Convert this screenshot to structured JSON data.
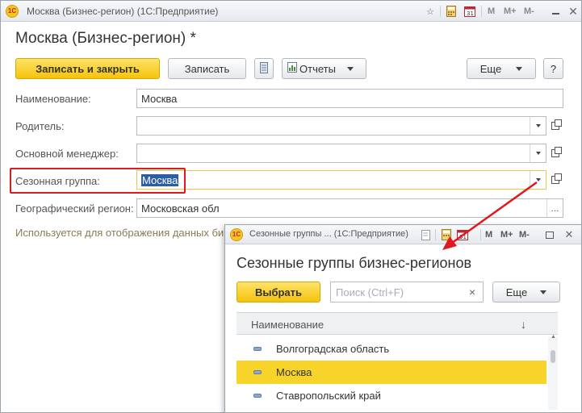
{
  "main_window": {
    "title": "Москва (Бизнес-регион)  (1С:Предприятие)",
    "toolbar_m_labels": [
      "M",
      "M+",
      "M-"
    ],
    "form_title": "Москва (Бизнес-регион) *",
    "buttons": {
      "write_close": "Записать и закрыть",
      "write": "Записать",
      "reports": "Отчеты",
      "more": "Еще",
      "help": "?"
    },
    "fields": {
      "name": {
        "label": "Наименование:",
        "value": "Москва"
      },
      "parent": {
        "label": "Родитель:",
        "value": ""
      },
      "manager": {
        "label": "Основной менеджер:",
        "value": ""
      },
      "season_group": {
        "label": "Сезонная группа:",
        "value": "Москва"
      },
      "geo_region": {
        "label": "Географический регион:",
        "value": "Московская обл"
      }
    },
    "hint": "Используется для отображения данных би"
  },
  "popup": {
    "title": "Сезонные группы ...  (1С:Предприятие)",
    "toolbar_m_labels": [
      "M",
      "M+",
      "M-"
    ],
    "heading": "Сезонные группы бизнес-регионов",
    "select_button": "Выбрать",
    "search_placeholder": "Поиск (Ctrl+F)",
    "clear_symbol": "×",
    "more_button": "Еще",
    "column_header": "Наименование",
    "sort_symbol": "↓",
    "rows": [
      {
        "label": "Волгоградская область",
        "selected": false
      },
      {
        "label": "Москва",
        "selected": true
      },
      {
        "label": "Ставропольский край",
        "selected": false
      }
    ]
  },
  "colors": {
    "accent_yellow": "#f8d42a",
    "selection_blue": "#2c5ea8",
    "annotation_red": "#e0191f"
  }
}
